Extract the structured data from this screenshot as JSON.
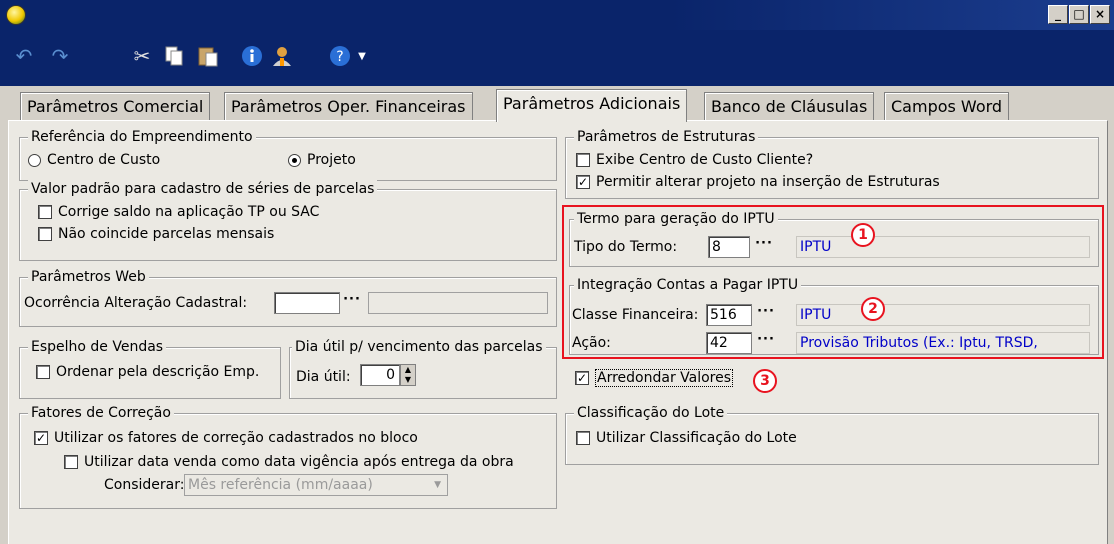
{
  "window": {
    "minimize": "_",
    "maximize": "□",
    "close": "×"
  },
  "toolbar": {
    "icons": [
      "undo-icon",
      "redo-icon",
      "cut-icon",
      "copy-icon",
      "paste-icon",
      "info-icon",
      "user-icon",
      "help-icon"
    ]
  },
  "tabs": [
    {
      "label": "Parâmetros Comercial"
    },
    {
      "label": "Parâmetros Oper. Financeiras"
    },
    {
      "label": "Parâmetros Adicionais"
    },
    {
      "label": "Banco de Cláusulas"
    },
    {
      "label": "Campos Word"
    }
  ],
  "referencia": {
    "title": "Referência do Empreendimento",
    "opt1": "Centro de Custo",
    "opt2": "Projeto"
  },
  "valor_padrao": {
    "title": "Valor padrão para cadastro de séries de parcelas",
    "chk1": "Corrige saldo na aplicação TP ou SAC",
    "chk2": "Não coincide parcelas mensais"
  },
  "web": {
    "title": "Parâmetros Web",
    "label": "Ocorrência Alteração Cadastral:",
    "dots": "···"
  },
  "espelho": {
    "title": "Espelho de Vendas",
    "chk": "Ordenar pela descrição Emp."
  },
  "dia_util": {
    "title": "Dia útil p/ vencimento das parcelas",
    "label": "Dia útil:",
    "value": "0"
  },
  "fatores": {
    "title": "Fatores de Correção",
    "chk1": "Utilizar os fatores de correção cadastrados no bloco",
    "chk2": "Utilizar data venda como data vigência após entrega da obra",
    "considerar_label": "Considerar:",
    "considerar_value": "Mês referência (mm/aaaa)"
  },
  "estruturas": {
    "title": "Parâmetros de Estruturas",
    "chk1": "Exibe Centro de Custo Cliente?",
    "chk2": "Permitir alterar projeto na inserção de Estruturas"
  },
  "termo": {
    "title": "Termo para geração do IPTU",
    "label": "Tipo do Termo:",
    "value": "8",
    "desc": "IPTU"
  },
  "integracao": {
    "title": "Integração Contas a Pagar IPTU",
    "classe_label": "Classe Financeira:",
    "classe_value": "516",
    "classe_desc": "IPTU",
    "acao_label": "Ação:",
    "acao_value": "42",
    "acao_desc": "Provisão Tributos (Ex.: Iptu, TRSD,"
  },
  "arredondar": "Arredondar Valores",
  "classificacao": {
    "title": "Classificação do Lote",
    "chk": "Utilizar Classificação do Lote"
  },
  "markers": [
    "1",
    "2",
    "3"
  ],
  "colors": {
    "annotation": "#e8131f",
    "link": "#0000c8",
    "title_bar": "#0a246a"
  }
}
